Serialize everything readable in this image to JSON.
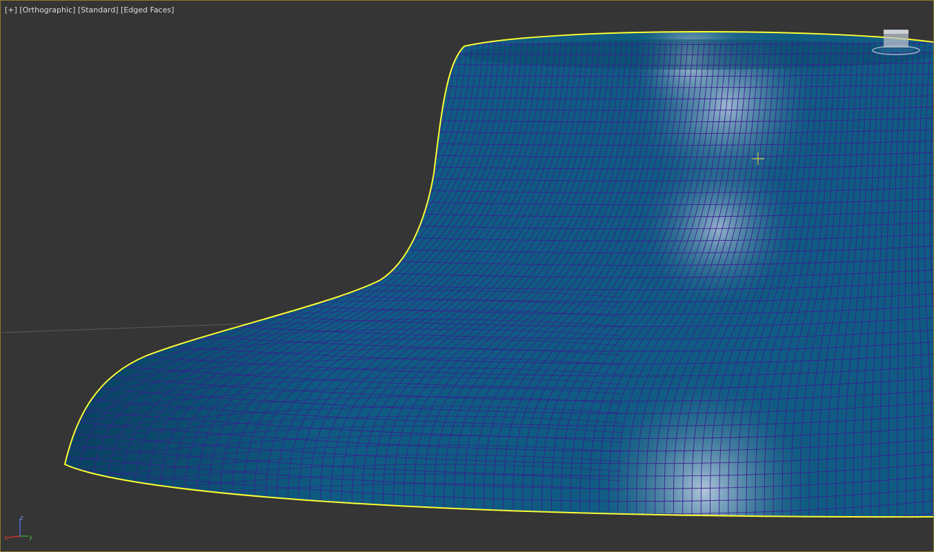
{
  "viewport": {
    "label_plus": "[+]",
    "label_view": "[Orthographic]",
    "label_shading": "[Standard]",
    "label_edges": "[Edged Faces]"
  },
  "axis_tripod": {
    "z_label": "z",
    "y_label": "y",
    "x_label": "x",
    "x_color": "#d03030",
    "y_color": "#3aa03a",
    "z_color": "#4a6ad8"
  },
  "colors": {
    "background": "#353535",
    "selection_outline": "#ffff33",
    "mesh_fill": "#0f5b82",
    "wire_color": "#3a1f8f",
    "cursor_color": "#e8e840"
  },
  "icons": {
    "viewcube": "viewcube-icon",
    "cursor": "crosshair-icon",
    "axis": "axis-tripod-icon"
  }
}
